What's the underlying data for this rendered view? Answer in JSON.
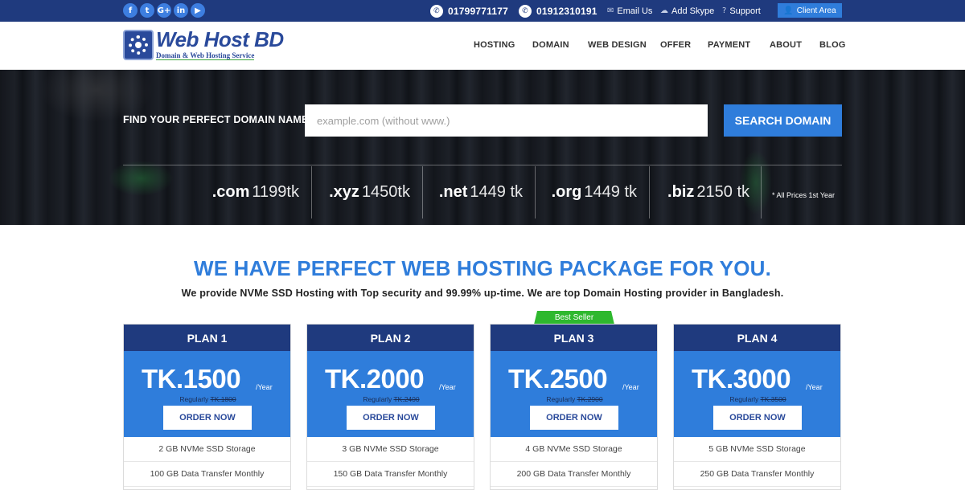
{
  "topbar": {
    "social": [
      {
        "icon": "facebook-icon",
        "glyph": "f"
      },
      {
        "icon": "twitter-icon",
        "glyph": "t"
      },
      {
        "icon": "google-plus-icon",
        "glyph": "G+"
      },
      {
        "icon": "linkedin-icon",
        "glyph": "in"
      },
      {
        "icon": "youtube-icon",
        "glyph": "▶"
      }
    ],
    "phone1": "01799771177",
    "phone2": "01912310191",
    "email_label": "Email Us",
    "skype_label": "Add Skype",
    "support_label": "Support",
    "client_area_label": "Client Area"
  },
  "header": {
    "logo_title": "Web Host BD",
    "logo_subtitle": "Domain & Web Hosting Service",
    "nav": [
      "HOSTING",
      "DOMAIN",
      "WEB DESIGN",
      "OFFER",
      "PAYMENT",
      "ABOUT",
      "BLOG"
    ]
  },
  "hero": {
    "find_label": "FIND YOUR PERFECT DOMAIN NAME:",
    "search_placeholder": "example.com (without www.)",
    "search_button": "SEARCH DOMAIN",
    "tlds": [
      {
        "ext": ".com",
        "price": "1199tk"
      },
      {
        "ext": ".xyz",
        "price": "1450tk"
      },
      {
        "ext": ".net",
        "price": "1449 tk"
      },
      {
        "ext": ".org",
        "price": "1449 tk"
      },
      {
        "ext": ".biz",
        "price": "2150 tk"
      }
    ],
    "note": "* All Prices 1st Year"
  },
  "section": {
    "title": "WE HAVE PERFECT WEB HOSTING PACKAGE FOR YOU.",
    "subtitle": "We provide NVMe SSD Hosting with Top security and 99.99% up-time. We are top Domain Hosting provider in Bangladesh."
  },
  "best_seller_label": "Best Seller",
  "plans": [
    {
      "name": "PLAN 1",
      "price": "TK.1500",
      "period": "/Year",
      "regular_label": "Regularly",
      "regular_price": "TK.1800",
      "order_label": "ORDER NOW",
      "storage": "2 GB NVMe SSD Storage",
      "transfer": "100 GB Data Transfer Monthly"
    },
    {
      "name": "PLAN 2",
      "price": "TK.2000",
      "period": "/Year",
      "regular_label": "Regularly",
      "regular_price": "TK.2400",
      "order_label": "ORDER NOW",
      "storage": "3 GB NVMe SSD Storage",
      "transfer": "150 GB Data Transfer Monthly"
    },
    {
      "name": "PLAN 3",
      "price": "TK.2500",
      "period": "/Year",
      "regular_label": "Regularly",
      "regular_price": "TK.2900",
      "order_label": "ORDER NOW",
      "storage": "4 GB NVMe SSD Storage",
      "transfer": "200 GB Data Transfer Monthly"
    },
    {
      "name": "PLAN 4",
      "price": "TK.3000",
      "period": "/Year",
      "regular_label": "Regularly",
      "regular_price": "TK.3500",
      "order_label": "ORDER NOW",
      "storage": "5 GB NVMe SSD Storage",
      "transfer": "250 GB Data Transfer Monthly"
    }
  ],
  "colors": {
    "navy": "#1f3a7e",
    "accent_blue": "#2f7ddb",
    "best_seller_green": "#2eb82e"
  }
}
